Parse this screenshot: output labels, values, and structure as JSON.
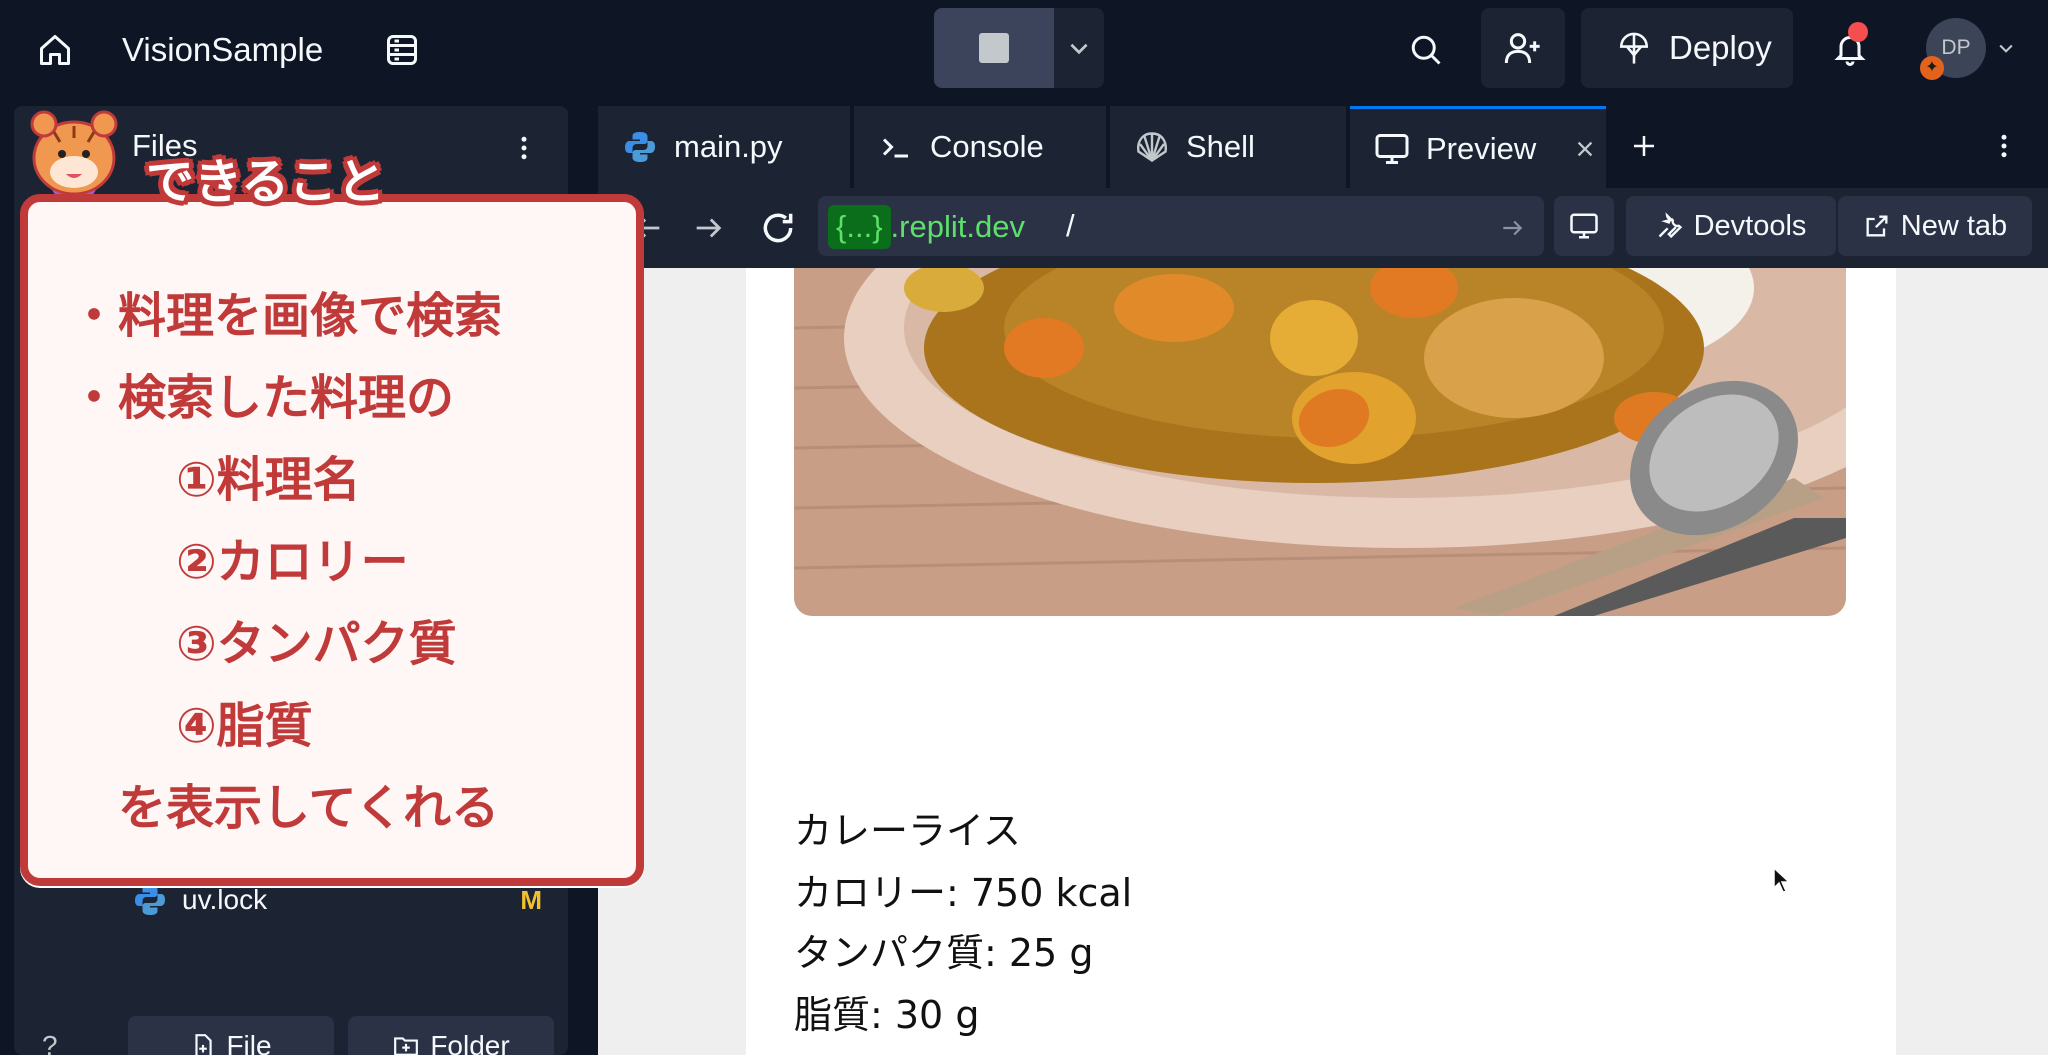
{
  "topbar": {
    "app_title": "VisionSample",
    "deploy_label": "Deploy",
    "avatar_initials": "DP"
  },
  "files": {
    "tab_label": "Files",
    "file_name": "uv.lock",
    "file_status": "M",
    "new_file_label": "File",
    "new_folder_label": "Folder",
    "help_label": "?"
  },
  "tabs": [
    {
      "label": "main.py",
      "icon": "python-icon"
    },
    {
      "label": "Console",
      "icon": "terminal-icon"
    },
    {
      "label": "Shell",
      "icon": "shell-icon"
    },
    {
      "label": "Preview",
      "icon": "monitor-icon"
    }
  ],
  "urlbar": {
    "host_chip": "{...}",
    "host_domain": ".replit.dev",
    "path": "/",
    "devtools_label": "Devtools",
    "newtab_label": "New tab"
  },
  "preview": {
    "dish_name": "カレーライス",
    "calories": "カロリー: 750 kcal",
    "protein": "タンパク質: 25 g",
    "fat": "脂質: 30 g"
  },
  "overlay": {
    "title": "できること",
    "lines": [
      "・料理を画像で検索",
      "・検索した料理の",
      "①料理名",
      "②カロリー",
      "③タンパク質",
      "④脂質",
      "を表示してくれる"
    ]
  },
  "colors": {
    "accent_red": "#c13a3a",
    "tab_active_border": "#0079f2",
    "url_green": "#5de06a"
  }
}
